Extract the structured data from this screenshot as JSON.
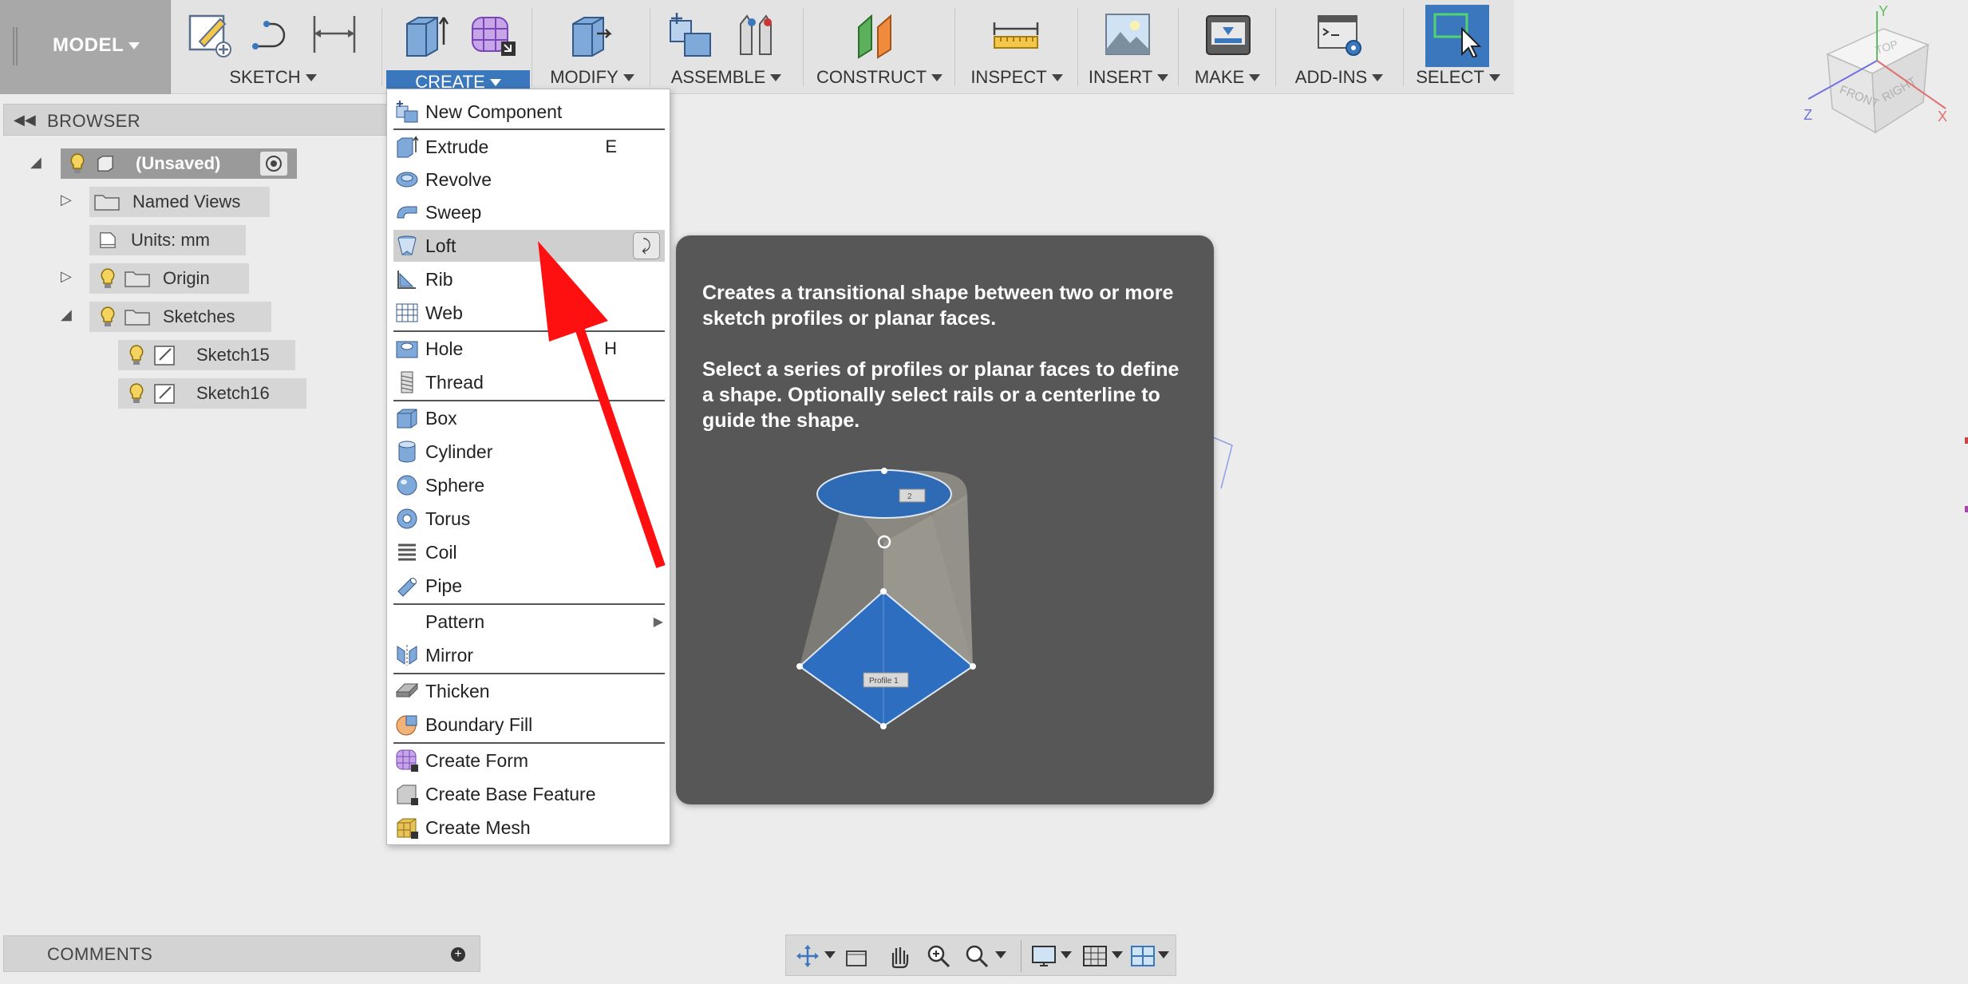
{
  "toolbar": {
    "model_label": "MODEL",
    "groups": [
      {
        "label": "SKETCH"
      },
      {
        "label": "CREATE"
      },
      {
        "label": "MODIFY"
      },
      {
        "label": "ASSEMBLE"
      },
      {
        "label": "CONSTRUCT"
      },
      {
        "label": "INSPECT"
      },
      {
        "label": "INSERT"
      },
      {
        "label": "MAKE"
      },
      {
        "label": "ADD-INS"
      },
      {
        "label": "SELECT"
      }
    ]
  },
  "browser": {
    "title": "BROWSER",
    "items": [
      {
        "label": "(Unsaved)"
      },
      {
        "label": "Named Views"
      },
      {
        "label": "Units: mm"
      },
      {
        "label": "Origin"
      },
      {
        "label": "Sketches"
      },
      {
        "label": "Sketch15"
      },
      {
        "label": "Sketch16"
      }
    ]
  },
  "create_menu": {
    "items": [
      {
        "label": "New Component",
        "key": ""
      },
      {
        "label": "Extrude",
        "key": "E"
      },
      {
        "label": "Revolve",
        "key": ""
      },
      {
        "label": "Sweep",
        "key": ""
      },
      {
        "label": "Loft",
        "key": ""
      },
      {
        "label": "Rib",
        "key": ""
      },
      {
        "label": "Web",
        "key": ""
      },
      {
        "label": "Hole",
        "key": "H"
      },
      {
        "label": "Thread",
        "key": ""
      },
      {
        "label": "Box",
        "key": ""
      },
      {
        "label": "Cylinder",
        "key": ""
      },
      {
        "label": "Sphere",
        "key": ""
      },
      {
        "label": "Torus",
        "key": ""
      },
      {
        "label": "Coil",
        "key": ""
      },
      {
        "label": "Pipe",
        "key": ""
      },
      {
        "label": "Pattern",
        "key": ""
      },
      {
        "label": "Mirror",
        "key": ""
      },
      {
        "label": "Thicken",
        "key": ""
      },
      {
        "label": "Boundary Fill",
        "key": ""
      },
      {
        "label": "Create Form",
        "key": ""
      },
      {
        "label": "Create Base Feature",
        "key": ""
      },
      {
        "label": "Create Mesh",
        "key": ""
      }
    ]
  },
  "tooltip": {
    "line1": "Creates a transitional shape between two or more sketch profiles or planar faces.",
    "line2": "Select a series of profiles or planar faces to define a shape. Optionally select rails or a centerline to guide the shape.",
    "profile1_label": "Profile 1",
    "profile2_label": "2"
  },
  "viewcube": {
    "top": "TOP",
    "front": "FRONT",
    "right": "RIGHT",
    "axis_x": "X",
    "axis_y": "Y",
    "axis_z": "Z"
  },
  "comments": {
    "title": "COMMENTS"
  },
  "colors": {
    "accent": "#3b77bd",
    "annotation_arrow": "#ff0000",
    "tooltip_bg": "#575757"
  }
}
